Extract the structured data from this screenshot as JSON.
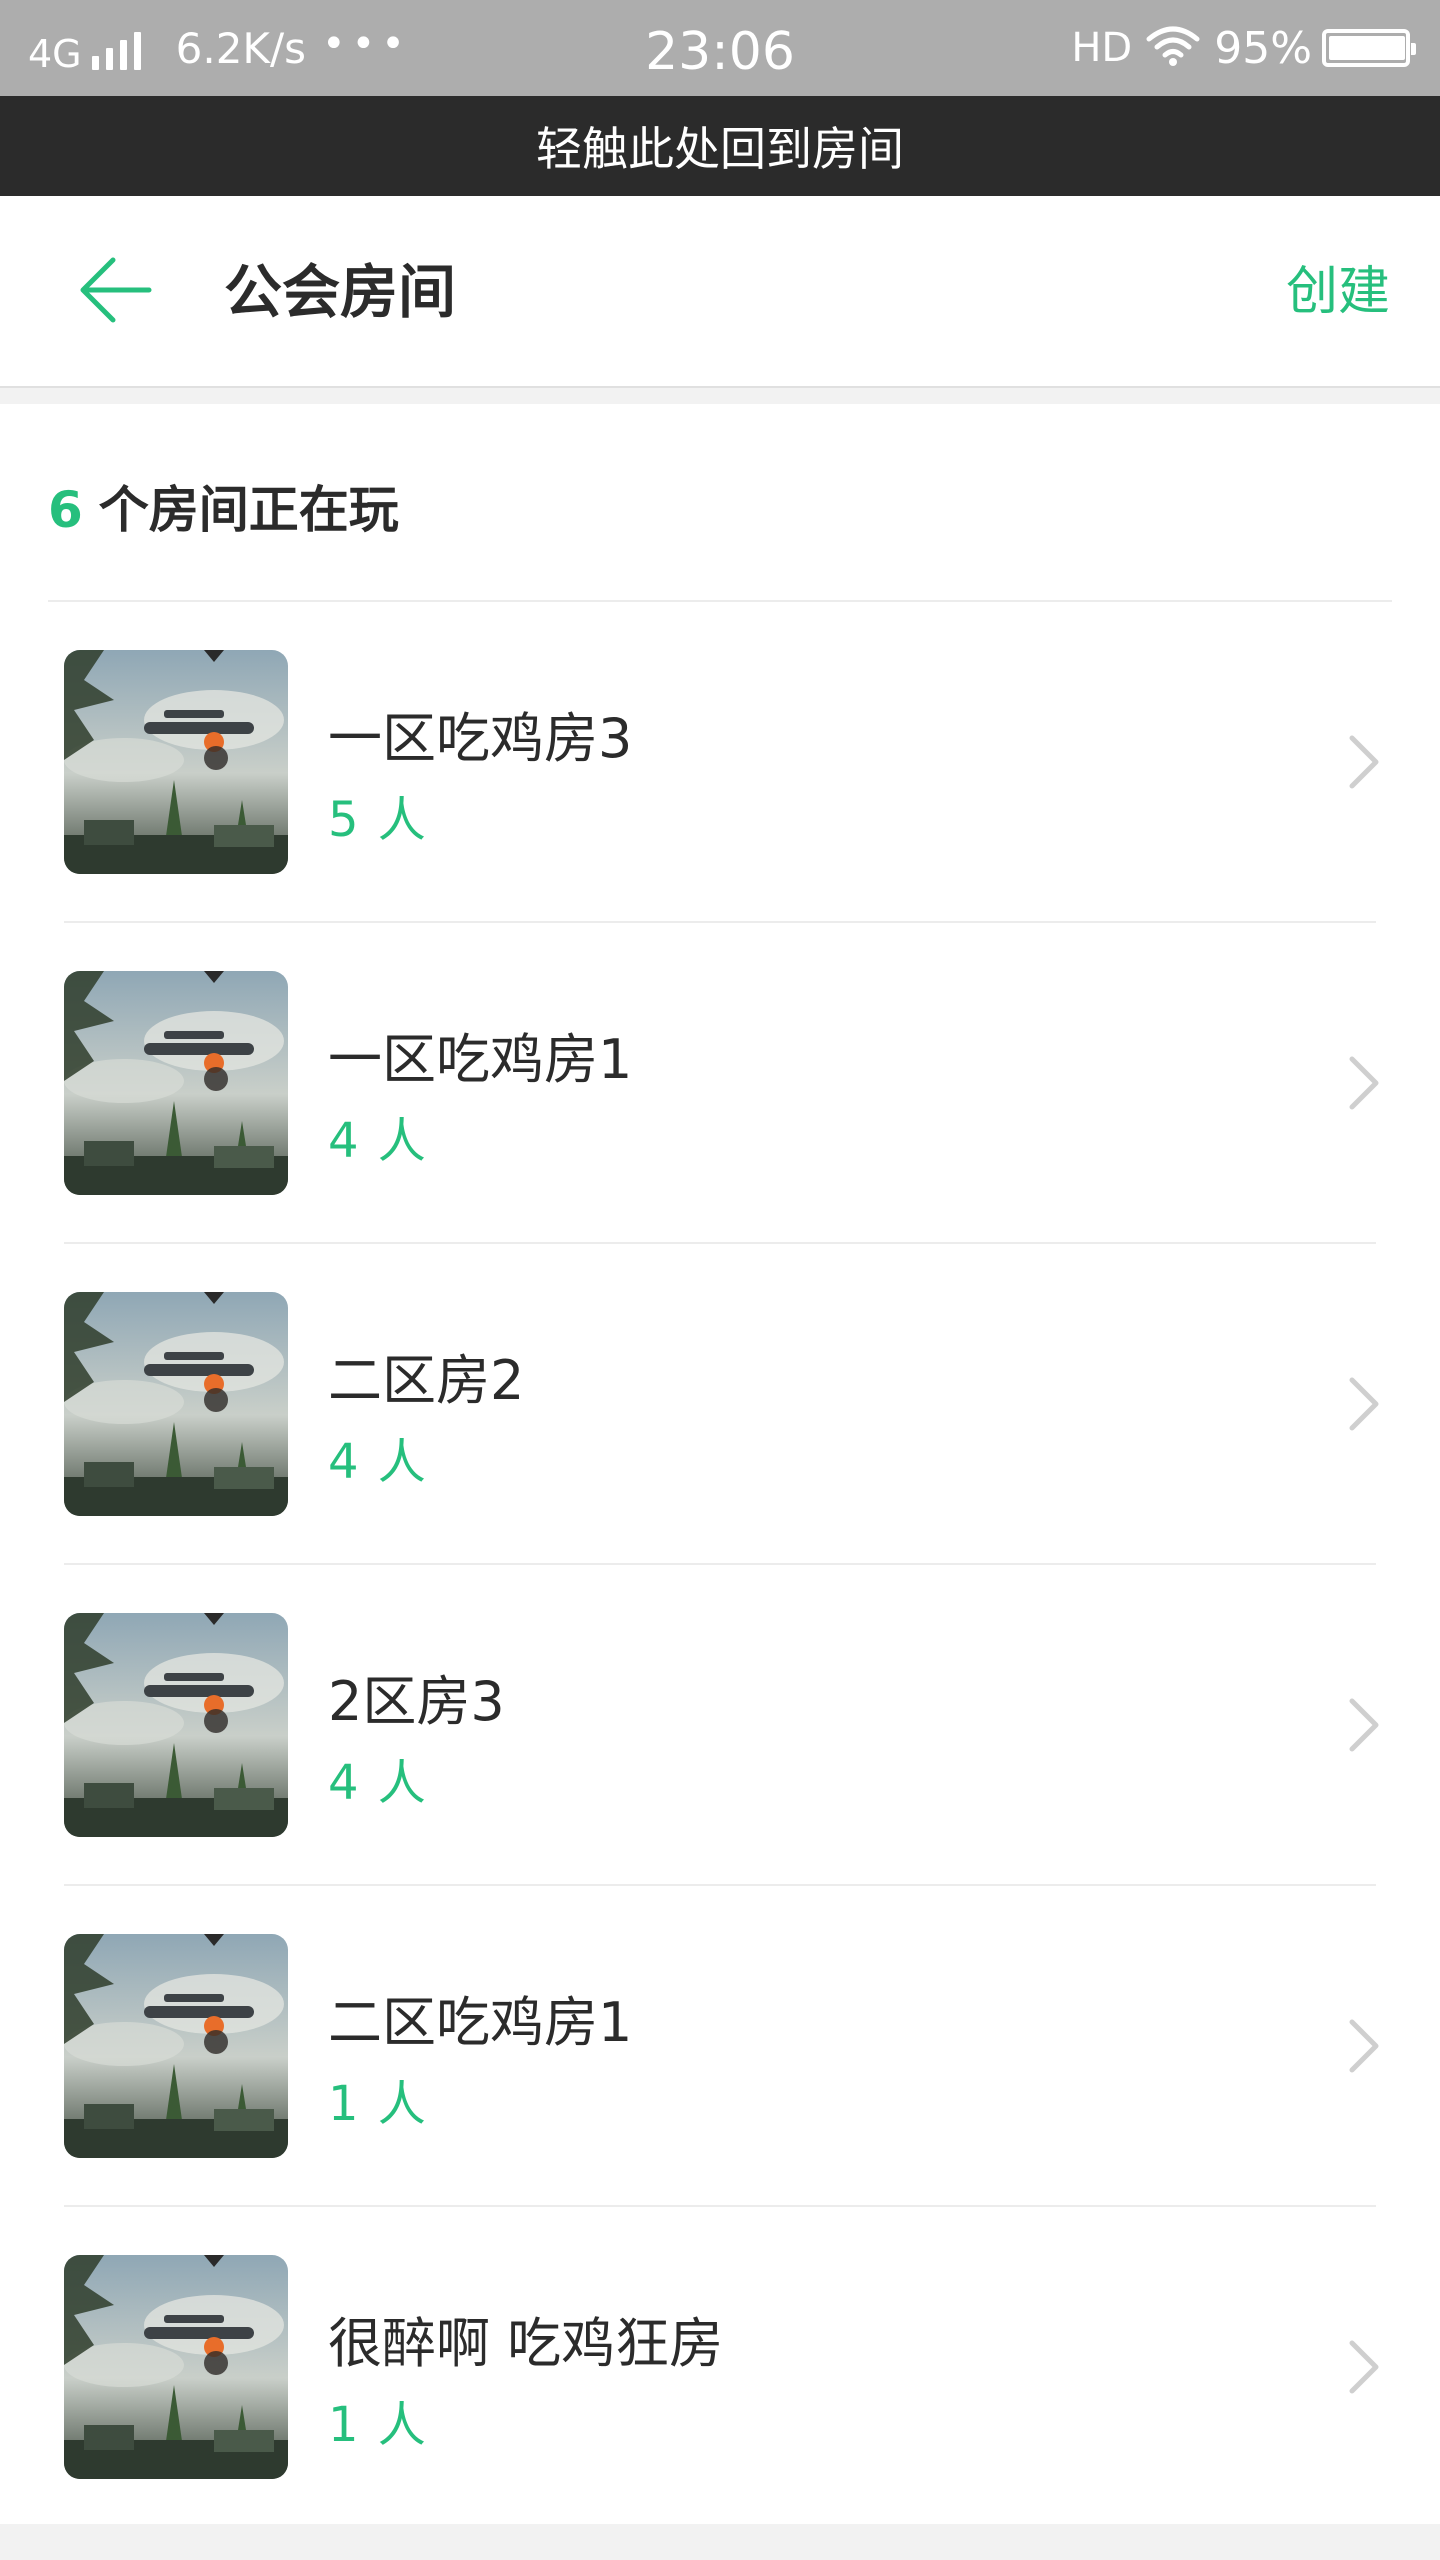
{
  "status_bar": {
    "network": "4G",
    "speed": "6.2K/s",
    "more": "•••",
    "time": "23:06",
    "hd": "HD",
    "battery": "95%"
  },
  "banner": {
    "text": "轻触此处回到房间"
  },
  "header": {
    "back_icon": "arrow-left-icon",
    "title": "公会房间",
    "create_label": "创建"
  },
  "summary": {
    "count": "6",
    "label": "个房间正在玩"
  },
  "rooms": [
    {
      "name": "一区吃鸡房3",
      "count": "5 人"
    },
    {
      "name": "一区吃鸡房1",
      "count": "4 人"
    },
    {
      "name": "二区房2",
      "count": "4 人"
    },
    {
      "name": "2区房3",
      "count": "4 人"
    },
    {
      "name": "二区吃鸡房1",
      "count": "1 人"
    },
    {
      "name": "很醉啊 吃鸡狂房",
      "count": "1 人"
    }
  ],
  "colors": {
    "accent": "#26bf7d",
    "banner": "#2b2b2b",
    "status_bar": "#adadad"
  }
}
